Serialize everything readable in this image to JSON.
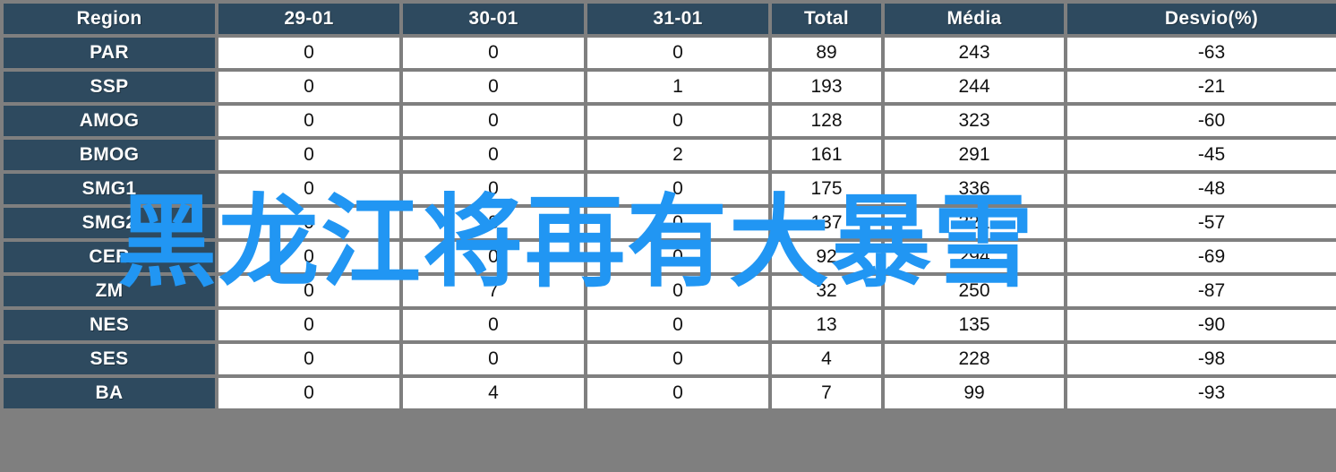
{
  "overlay": {
    "watermark_text": "黑龙江将再有大暴雪",
    "watermark_color": "#2196f3"
  },
  "theme": {
    "header_bg": "#2e4a5f",
    "header_text": "#ffffff",
    "cell_bg": "#ffffff",
    "cell_text": "#111111",
    "grid_line": "#7f7f7f",
    "page_bg": "#f4f4f4"
  },
  "table": {
    "columns": [
      "Region",
      "29-01",
      "30-01",
      "31-01",
      "Total",
      "Média",
      "Desvio(%)"
    ],
    "rows": [
      {
        "region": "PAR",
        "d29": "0",
        "d30": "0",
        "d31": "0",
        "total": "89",
        "media": "243",
        "desvio": "-63"
      },
      {
        "region": "SSP",
        "d29": "0",
        "d30": "0",
        "d31": "1",
        "total": "193",
        "media": "244",
        "desvio": "-21"
      },
      {
        "region": "AMOG",
        "d29": "0",
        "d30": "0",
        "d31": "0",
        "total": "128",
        "media": "323",
        "desvio": "-60"
      },
      {
        "region": "BMOG",
        "d29": "0",
        "d30": "0",
        "d31": "2",
        "total": "161",
        "media": "291",
        "desvio": "-45"
      },
      {
        "region": "SMG1",
        "d29": "0",
        "d30": "0",
        "d31": "0",
        "total": "175",
        "media": "336",
        "desvio": "-48"
      },
      {
        "region": "SMG2",
        "d29": "0",
        "d30": "8",
        "d31": "0",
        "total": "137",
        "media": "321",
        "desvio": "-57"
      },
      {
        "region": "CER",
        "d29": "0",
        "d30": "0",
        "d31": "0",
        "total": "92",
        "media": "294",
        "desvio": "-69"
      },
      {
        "region": "ZM",
        "d29": "0",
        "d30": "7",
        "d31": "0",
        "total": "32",
        "media": "250",
        "desvio": "-87"
      },
      {
        "region": "NES",
        "d29": "0",
        "d30": "0",
        "d31": "0",
        "total": "13",
        "media": "135",
        "desvio": "-90"
      },
      {
        "region": "SES",
        "d29": "0",
        "d30": "0",
        "d31": "0",
        "total": "4",
        "media": "228",
        "desvio": "-98"
      },
      {
        "region": "BA",
        "d29": "0",
        "d30": "4",
        "d31": "0",
        "total": "7",
        "media": "99",
        "desvio": "-93"
      }
    ]
  },
  "chart_data": {
    "type": "table",
    "title": "",
    "columns": [
      "Region",
      "29-01",
      "30-01",
      "31-01",
      "Total",
      "Média",
      "Desvio(%)"
    ],
    "categories": [
      "PAR",
      "SSP",
      "AMOG",
      "BMOG",
      "SMG1",
      "SMG2",
      "CER",
      "ZM",
      "NES",
      "SES",
      "BA"
    ],
    "series": [
      {
        "name": "29-01",
        "values": [
          0,
          0,
          0,
          0,
          0,
          0,
          0,
          0,
          0,
          0,
          0
        ]
      },
      {
        "name": "30-01",
        "values": [
          0,
          0,
          0,
          0,
          0,
          8,
          0,
          7,
          0,
          0,
          4
        ]
      },
      {
        "name": "31-01",
        "values": [
          0,
          0,
          0,
          2,
          0,
          0,
          0,
          0,
          0,
          0,
          0
        ]
      },
      {
        "name": "Total",
        "values": [
          89,
          193,
          128,
          161,
          175,
          137,
          92,
          32,
          13,
          4,
          7
        ]
      },
      {
        "name": "Média",
        "values": [
          243,
          244,
          323,
          291,
          336,
          321,
          294,
          250,
          135,
          228,
          99
        ]
      },
      {
        "name": "Desvio(%)",
        "values": [
          -63,
          -21,
          -60,
          -45,
          -48,
          -57,
          -69,
          -87,
          -90,
          -98,
          -93
        ]
      }
    ],
    "xlabel": "Region",
    "ylabel": ""
  }
}
